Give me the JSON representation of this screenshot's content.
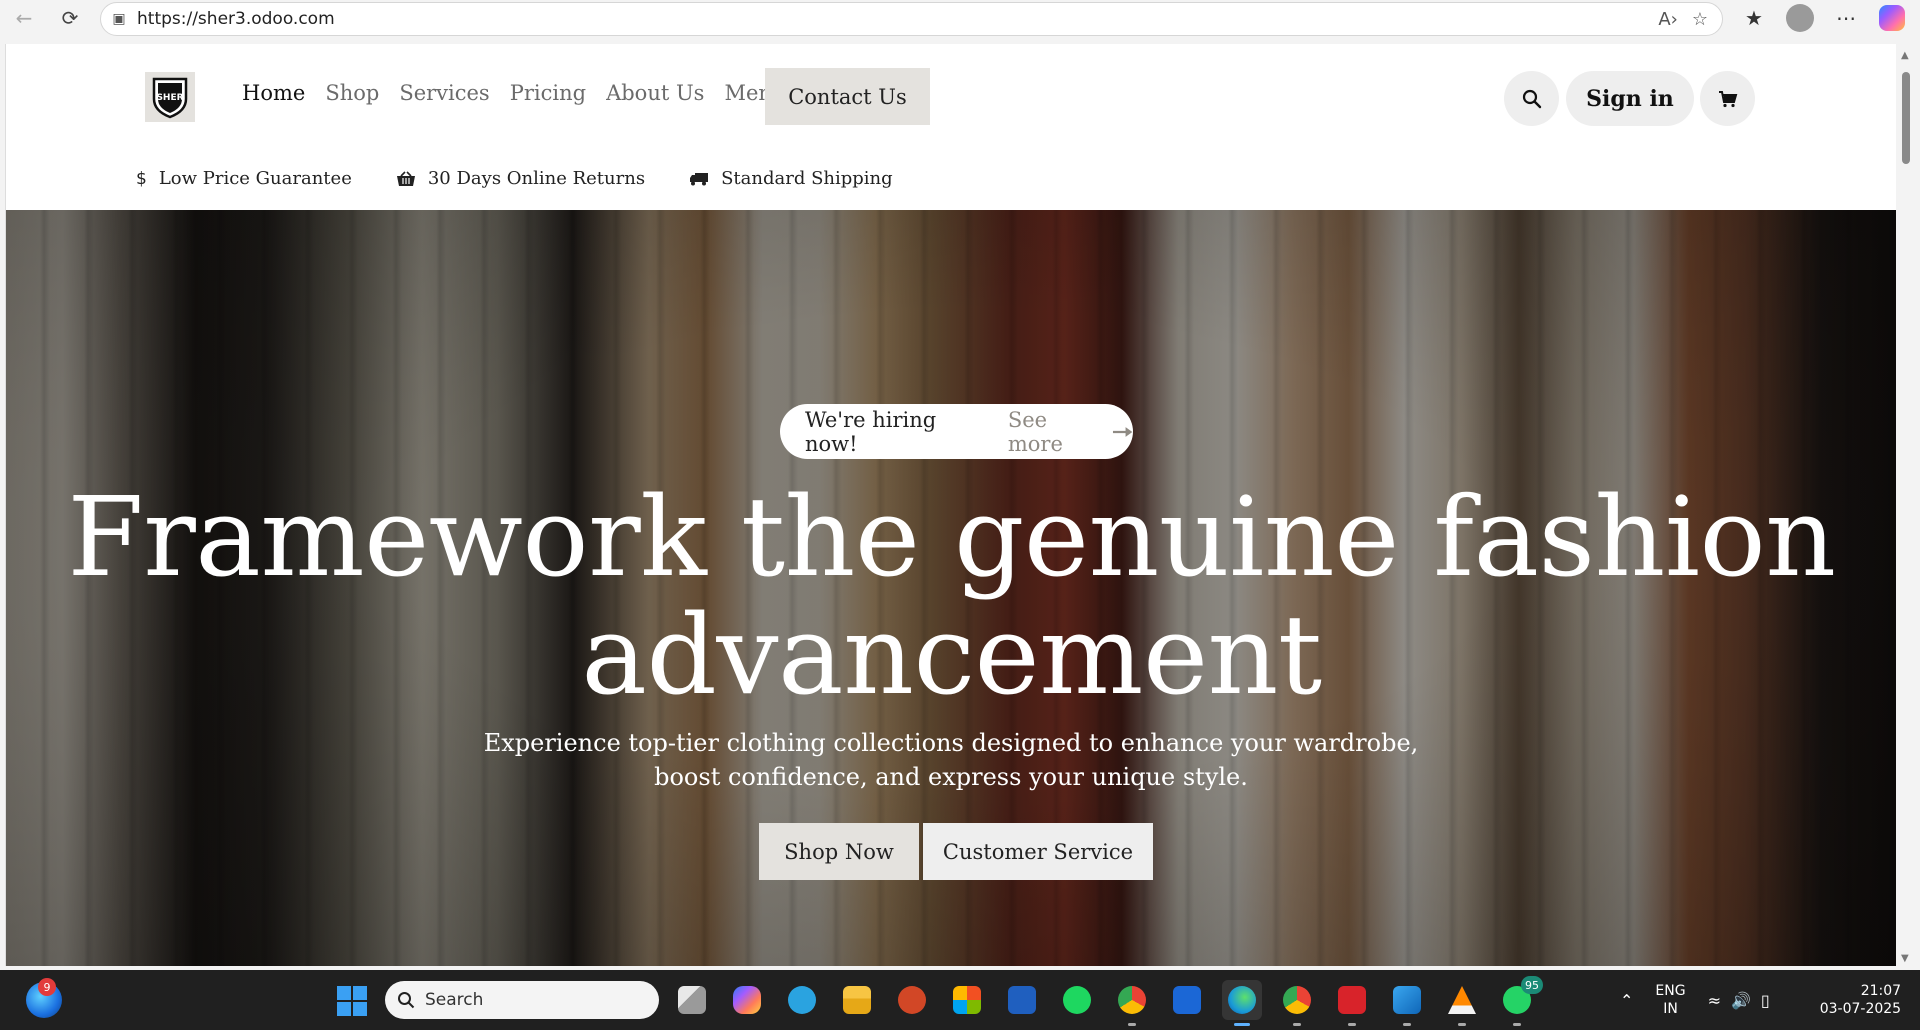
{
  "browser": {
    "url": "https://sher3.odoo.com"
  },
  "site": {
    "logo_text": "SHER",
    "nav": [
      "Home",
      "Shop",
      "Services",
      "Pricing",
      "About Us",
      "Menu"
    ],
    "contact_button": "Contact Us",
    "sign_in": "Sign in",
    "features": [
      "Low Price Guarantee",
      "30 Days Online Returns",
      "Standard Shipping"
    ]
  },
  "hero": {
    "pill_text": "We're hiring now!",
    "pill_link": "See more",
    "headline_line1": "Framework the genuine fashion",
    "headline_line2": "advancement",
    "subtitle_line1": "Experience top-tier clothing collections designed to enhance your wardrobe,",
    "subtitle_line2": "boost confidence, and express your unique style.",
    "btn_shop": "Shop Now",
    "btn_service": "Customer Service"
  },
  "taskbar": {
    "widget_badge": "9",
    "search_placeholder": "Search",
    "whatsapp_badge": "95",
    "lang_line1": "ENG",
    "lang_line2": "IN",
    "time": "21:07",
    "date": "03-07-2025",
    "apps": [
      "task-view",
      "copilot",
      "telegram",
      "file-explorer",
      "powerpoint",
      "microsoft-store",
      "devhome",
      "spotify",
      "chrome",
      "mailbird",
      "edge",
      "chrome-profile",
      "acrobat",
      "vscode",
      "vlc",
      "whatsapp"
    ]
  },
  "colors": {
    "accent_button": "#e4e2de",
    "taskbar": "#202020",
    "hero_text": "#ffffff"
  }
}
